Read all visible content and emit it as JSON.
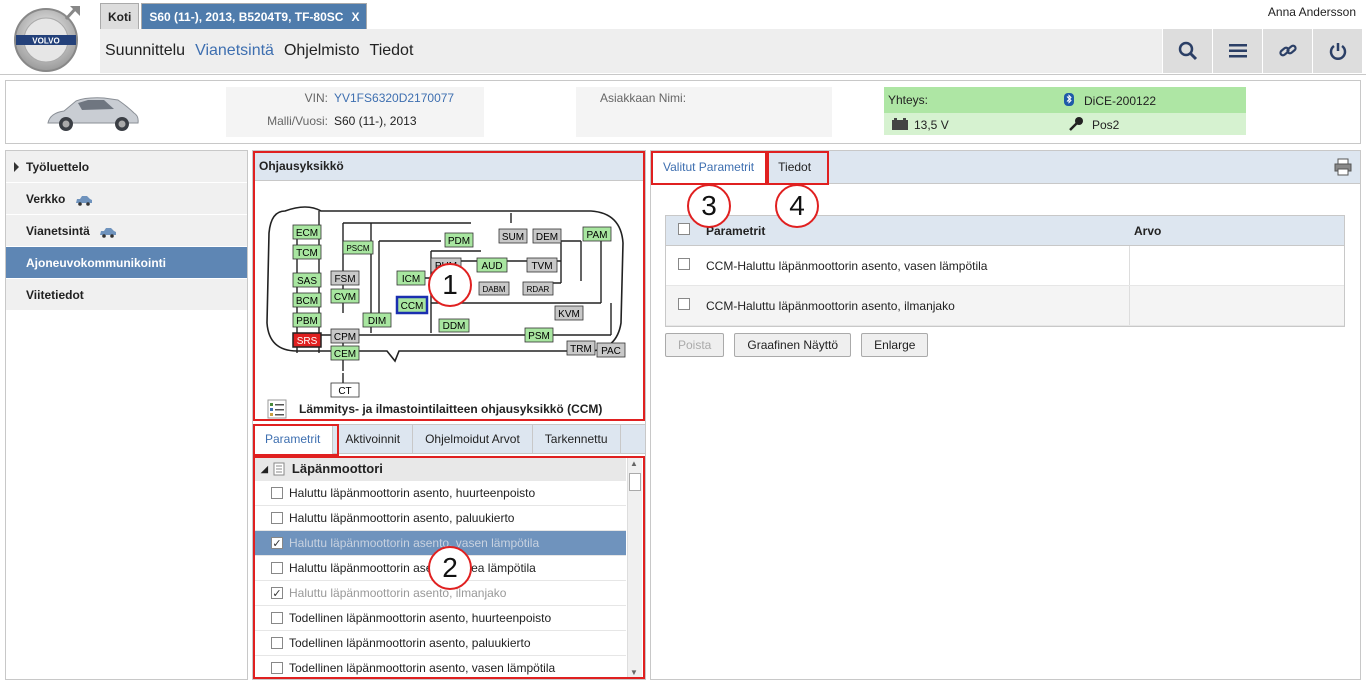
{
  "header": {
    "tabs": [
      {
        "label": "Koti"
      },
      {
        "label": "S60 (11-), 2013, B5204T9, TF-80SC",
        "close": "X"
      }
    ],
    "nav": [
      "Suunnittelu",
      "Vianetsintä",
      "Ohjelmisto",
      "Tiedot"
    ],
    "nav_active": "Vianetsintä",
    "user": "Anna Andersson",
    "logo_text": "VOLVO"
  },
  "vehicle": {
    "vin_label": "VIN:",
    "vin_value": "YV1FS6320D2170077",
    "model_label": "Malli/Vuosi:",
    "model_value": "S60 (11-), 2013",
    "customer_label": "Asiakkaan Nimi:",
    "conn_label": "Yhteys:",
    "conn_device": "DiCE-200122",
    "voltage": "13,5 V",
    "key_pos": "Pos2"
  },
  "sidebar": {
    "items": [
      {
        "label": "Työluettelo"
      },
      {
        "label": "Verkko"
      },
      {
        "label": "Vianetsintä"
      },
      {
        "label": "Ajoneuvokommunikointi"
      },
      {
        "label": "Viitetiedot"
      }
    ]
  },
  "ecu": {
    "title": "Ohjausyksikkö",
    "selected_name": "Lämmitys- ja ilmastointilaitteen ohjausyksikkö (CCM)",
    "modules": [
      "ECM",
      "TCM",
      "PSCM",
      "PDM",
      "SUM",
      "DEM",
      "PAM",
      "ICM",
      "PHM",
      "AUD",
      "TVM",
      "FSM",
      "CCM",
      "DABM",
      "RDAR",
      "SAS",
      "CVM",
      "BCM",
      "KVM",
      "PBM",
      "DIM",
      "DDM",
      "SRS",
      "CPM",
      "PSM",
      "TRM",
      "PAC",
      "CEM",
      "CT"
    ]
  },
  "center_tabs": [
    "Parametrit",
    "Aktivoinnit",
    "Ohjelmoidut Arvot",
    "Tarkennettu"
  ],
  "param_list": {
    "group": "Läpänmoottori",
    "rows": [
      {
        "label": "Haluttu läpänmoottorin asento, huurteenpoisto",
        "checked": false
      },
      {
        "label": "Haluttu läpänmoottorin asento, paluukierto",
        "checked": false
      },
      {
        "label": "Haluttu läpänmoottorin asento, vasen lämpötila",
        "checked": true
      },
      {
        "label": "Haluttu läpänmoottorin asento, oikea lämpötila",
        "checked": false
      },
      {
        "label": "Haluttu läpänmoottorin asento, ilmanjako",
        "checked": true
      },
      {
        "label": "Todellinen läpänmoottorin asento, huurteenpoisto",
        "checked": false
      },
      {
        "label": "Todellinen läpänmoottorin asento, paluukierto",
        "checked": false
      },
      {
        "label": "Todellinen läpänmoottorin asento, vasen lämpötila",
        "checked": false
      }
    ]
  },
  "right_tabs": [
    "Valitut Parametrit",
    "Tiedot"
  ],
  "selected_table": {
    "col_param": "Parametrit",
    "col_value": "Arvo",
    "rows": [
      {
        "param": "CCM-Haluttu läpänmoottorin asento, vasen lämpötila",
        "value": ""
      },
      {
        "param": "CCM-Haluttu läpänmoottorin asento, ilmanjako",
        "value": ""
      }
    ]
  },
  "buttons": {
    "remove": "Poista",
    "graph": "Graafinen Näyttö",
    "enlarge": "Enlarge"
  },
  "callouts": [
    "1",
    "2",
    "3",
    "4"
  ],
  "colors": {
    "accent": "#3e6fb0",
    "sidebar_active": "#5e86b4",
    "panel_header": "#dde6f0",
    "module_green": "#a8e6a0",
    "module_gray": "#c8c8c8",
    "module_red": "#e02020",
    "highlight": "#e02020"
  }
}
